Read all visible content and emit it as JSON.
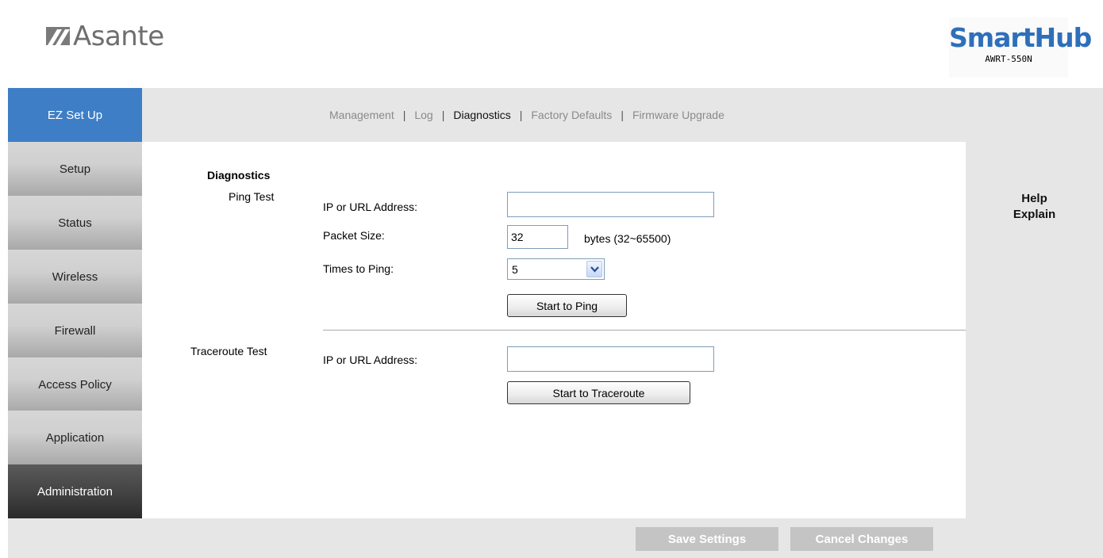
{
  "header": {
    "logo_text": "Asante",
    "brand_name": "SmartHub",
    "brand_model": "AWRT-550N"
  },
  "sidebar": {
    "items": [
      {
        "label": "EZ Set Up"
      },
      {
        "label": "Setup"
      },
      {
        "label": "Status"
      },
      {
        "label": "Wireless"
      },
      {
        "label": "Firewall"
      },
      {
        "label": "Access Policy"
      },
      {
        "label": "Application"
      },
      {
        "label": "Administration"
      }
    ],
    "active": "Administration"
  },
  "tabs": {
    "items": [
      "Management",
      "Log",
      "Diagnostics",
      "Factory Defaults",
      "Firmware Upgrade"
    ],
    "separator": "|",
    "active": "Diagnostics"
  },
  "diagnostics": {
    "title": "Diagnostics",
    "ping": {
      "section_label": "Ping Test",
      "address_label": "IP or URL Address:",
      "address_value": "",
      "packet_label": "Packet Size:",
      "packet_value": "32",
      "packet_unit": "bytes (32~65500)",
      "times_label": "Times to Ping:",
      "times_value": "5",
      "start_button": "Start to Ping"
    },
    "traceroute": {
      "section_label": "Traceroute Test",
      "address_label": "IP or URL Address:",
      "address_value": "",
      "start_button": "Start to Traceroute"
    }
  },
  "help": {
    "line1": "Help",
    "line2": "Explain"
  },
  "footer": {
    "save_label": "Save Settings",
    "cancel_label": "Cancel Changes"
  },
  "colors": {
    "ez_setup_bg": "#3d7ec7",
    "brand_blue": "#2e6fba",
    "panel_grey": "#e6e6e6",
    "button_disabled": "#c4c4c4"
  }
}
